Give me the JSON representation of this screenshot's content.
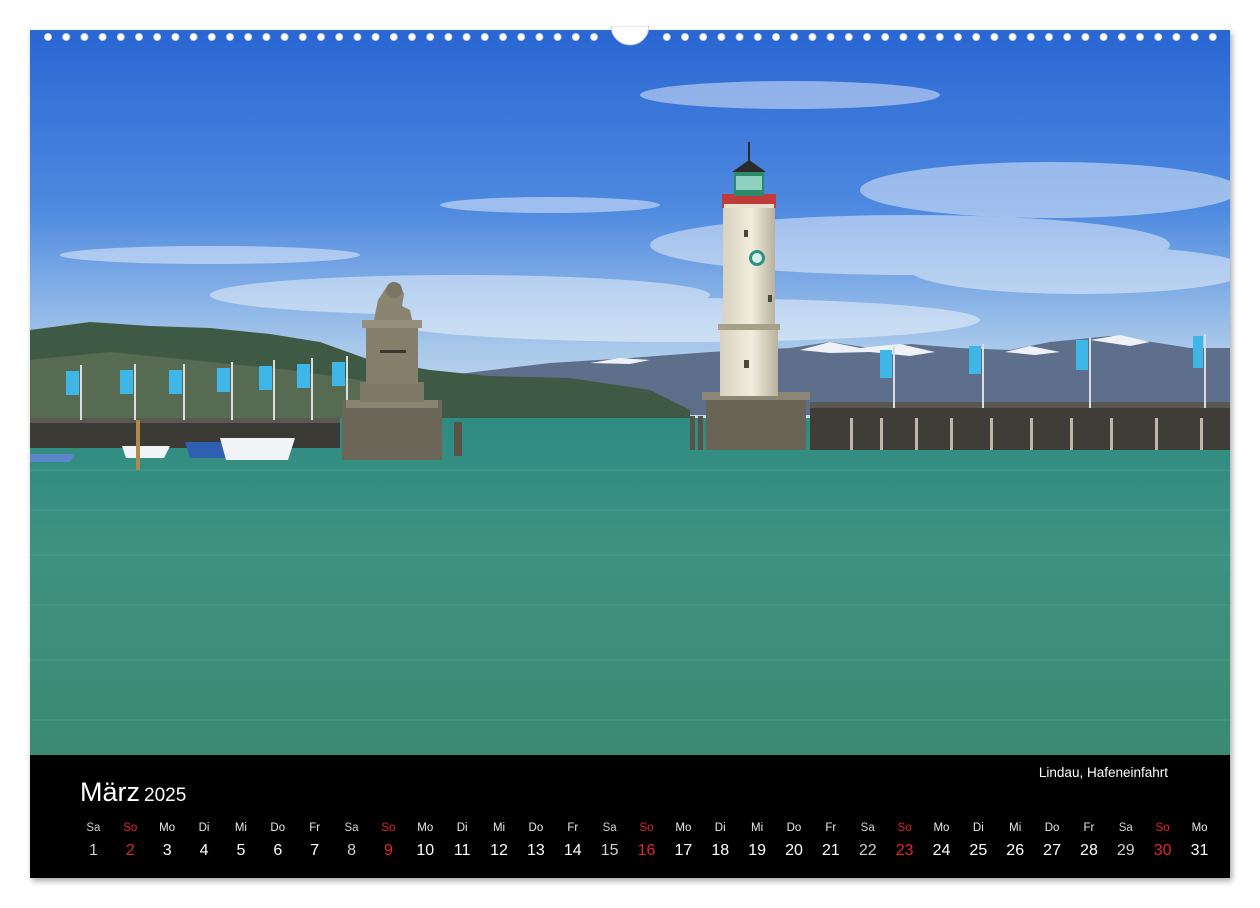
{
  "photo": {
    "caption": "Lindau, Hafeneinfahrt",
    "colors": {
      "sky_top": "#2f6fd6",
      "sky_bottom": "#bcd6ec",
      "lake": "#3f8f7f",
      "mountains": "#55657f"
    }
  },
  "calendar": {
    "month": "März",
    "year": "2025",
    "sunday_color": "#e3262b",
    "days": [
      {
        "wd": "Sa",
        "n": "1",
        "kind": "sat"
      },
      {
        "wd": "So",
        "n": "2",
        "kind": "sun"
      },
      {
        "wd": "Mo",
        "n": "3",
        "kind": "wk"
      },
      {
        "wd": "Di",
        "n": "4",
        "kind": "wk"
      },
      {
        "wd": "Mi",
        "n": "5",
        "kind": "wk"
      },
      {
        "wd": "Do",
        "n": "6",
        "kind": "wk"
      },
      {
        "wd": "Fr",
        "n": "7",
        "kind": "wk"
      },
      {
        "wd": "Sa",
        "n": "8",
        "kind": "sat"
      },
      {
        "wd": "So",
        "n": "9",
        "kind": "sun"
      },
      {
        "wd": "Mo",
        "n": "10",
        "kind": "wk"
      },
      {
        "wd": "Di",
        "n": "11",
        "kind": "wk"
      },
      {
        "wd": "Mi",
        "n": "12",
        "kind": "wk"
      },
      {
        "wd": "Do",
        "n": "13",
        "kind": "wk"
      },
      {
        "wd": "Fr",
        "n": "14",
        "kind": "wk"
      },
      {
        "wd": "Sa",
        "n": "15",
        "kind": "sat"
      },
      {
        "wd": "So",
        "n": "16",
        "kind": "sun"
      },
      {
        "wd": "Mo",
        "n": "17",
        "kind": "wk"
      },
      {
        "wd": "Di",
        "n": "18",
        "kind": "wk"
      },
      {
        "wd": "Mi",
        "n": "19",
        "kind": "wk"
      },
      {
        "wd": "Do",
        "n": "20",
        "kind": "wk"
      },
      {
        "wd": "Fr",
        "n": "21",
        "kind": "wk"
      },
      {
        "wd": "Sa",
        "n": "22",
        "kind": "sat"
      },
      {
        "wd": "So",
        "n": "23",
        "kind": "sun"
      },
      {
        "wd": "Mo",
        "n": "24",
        "kind": "wk"
      },
      {
        "wd": "Di",
        "n": "25",
        "kind": "wk"
      },
      {
        "wd": "Mi",
        "n": "26",
        "kind": "wk"
      },
      {
        "wd": "Do",
        "n": "27",
        "kind": "wk"
      },
      {
        "wd": "Fr",
        "n": "28",
        "kind": "wk"
      },
      {
        "wd": "Sa",
        "n": "29",
        "kind": "sat"
      },
      {
        "wd": "So",
        "n": "30",
        "kind": "sun"
      },
      {
        "wd": "Mo",
        "n": "31",
        "kind": "wk"
      }
    ]
  }
}
